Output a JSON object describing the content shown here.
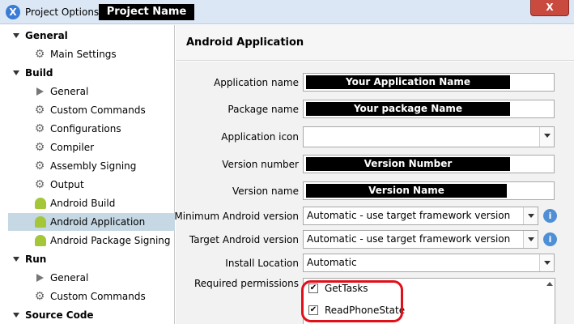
{
  "window": {
    "title": "Project Options -",
    "project_name": "Project Name",
    "close_label": "X"
  },
  "tree": {
    "sections": [
      {
        "label": "General",
        "items": [
          "Main Settings"
        ]
      },
      {
        "label": "Build",
        "items": [
          "General",
          "Custom Commands",
          "Configurations",
          "Compiler",
          "Assembly Signing",
          "Output",
          "Android Build",
          "Android Application",
          "Android Package Signing"
        ]
      },
      {
        "label": "Run",
        "items": [
          "General",
          "Custom Commands"
        ]
      },
      {
        "label": "Source Code",
        "items": []
      }
    ],
    "selected": "Android Application"
  },
  "pane": {
    "title": "Android Application"
  },
  "form": {
    "application_name_label": "Application name",
    "application_name_value": "Your Application Name",
    "package_name_label": "Package name",
    "package_name_value": "Your package Name",
    "application_icon_label": "Application icon",
    "application_icon_value": "",
    "version_number_label": "Version number",
    "version_number_value": "Version Number",
    "version_name_label": "Version name",
    "version_name_value": "Version Name",
    "min_android_label": "Minimum Android version",
    "min_android_value": "Automatic - use target framework version",
    "target_android_label": "Target Android version",
    "target_android_value": "Automatic - use target framework version",
    "install_location_label": "Install Location",
    "install_location_value": "Automatic",
    "permissions_label": "Required permissions",
    "permissions": [
      {
        "name": "GetTasks",
        "checked": true
      },
      {
        "name": "ReadPhoneState",
        "checked": true
      }
    ],
    "info_glyph": "i",
    "check_glyph": "✔"
  },
  "colors": {
    "selection": "#c5d8e4",
    "highlight": "#e0101a",
    "android_green": "#a4c639"
  }
}
